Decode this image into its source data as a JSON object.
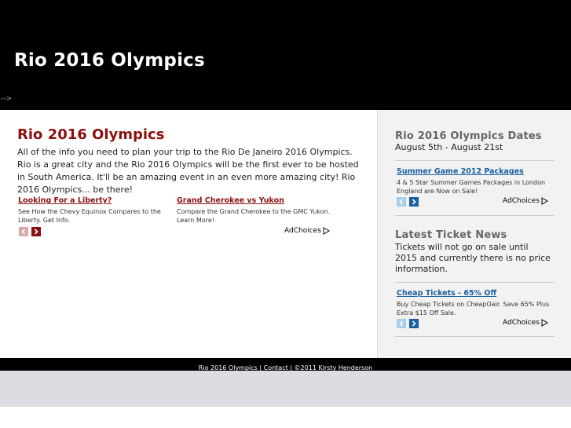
{
  "header": {
    "title": "Rio 2016 Olympics",
    "stray_text": "-->"
  },
  "main": {
    "title": "Rio 2016 Olympics",
    "body": "All of the info you need to plan your trip to the Rio De Janeiro 2016 Olympics. Rio is a great city and the Rio 2016 Olympics will be the first ever to be hosted in South America. It'll be an amazing event in an even more amazing city! Rio 2016 Olympics... be there!",
    "ads": [
      {
        "link": "Looking For a Liberty?",
        "text": "See How the Chevy Equinox Compares to the Liberty. Get Info."
      },
      {
        "link": "Grand Cherokee vs Yukon",
        "text": "Compare the Grand Cherokee to the GMC Yukon. Learn More!"
      }
    ],
    "adchoices": "AdChoices"
  },
  "sidebar": {
    "dates_heading": "Rio 2016 Olympics Dates",
    "dates_text": "August 5th - August 21st",
    "ad1": {
      "link": "Summer Game 2012 Packages",
      "text": "4 & 5 Star Summer Games Packages in London England are Now on Sale!",
      "adchoices": "AdChoices"
    },
    "news_heading": "Latest Ticket News",
    "news_text": "Tickets will not go on sale until 2015 and currently there is no price information.",
    "ad2": {
      "link": "Cheap Tickets - 65% Off",
      "text": "Buy Cheap Tickets on CheapOair. Save 65% Plus Extra $15 Off Sale.",
      "adchoices": "AdChoices"
    }
  },
  "footer": {
    "text": "Rio 2016 Olympics | Contact | ©2011 Kirsty Henderson"
  },
  "colors": {
    "header_bg": "#000000",
    "title_red": "#8b1010",
    "sidebar_link_blue": "#1a5fa0",
    "sidebar_bg": "#f2f2f2"
  }
}
